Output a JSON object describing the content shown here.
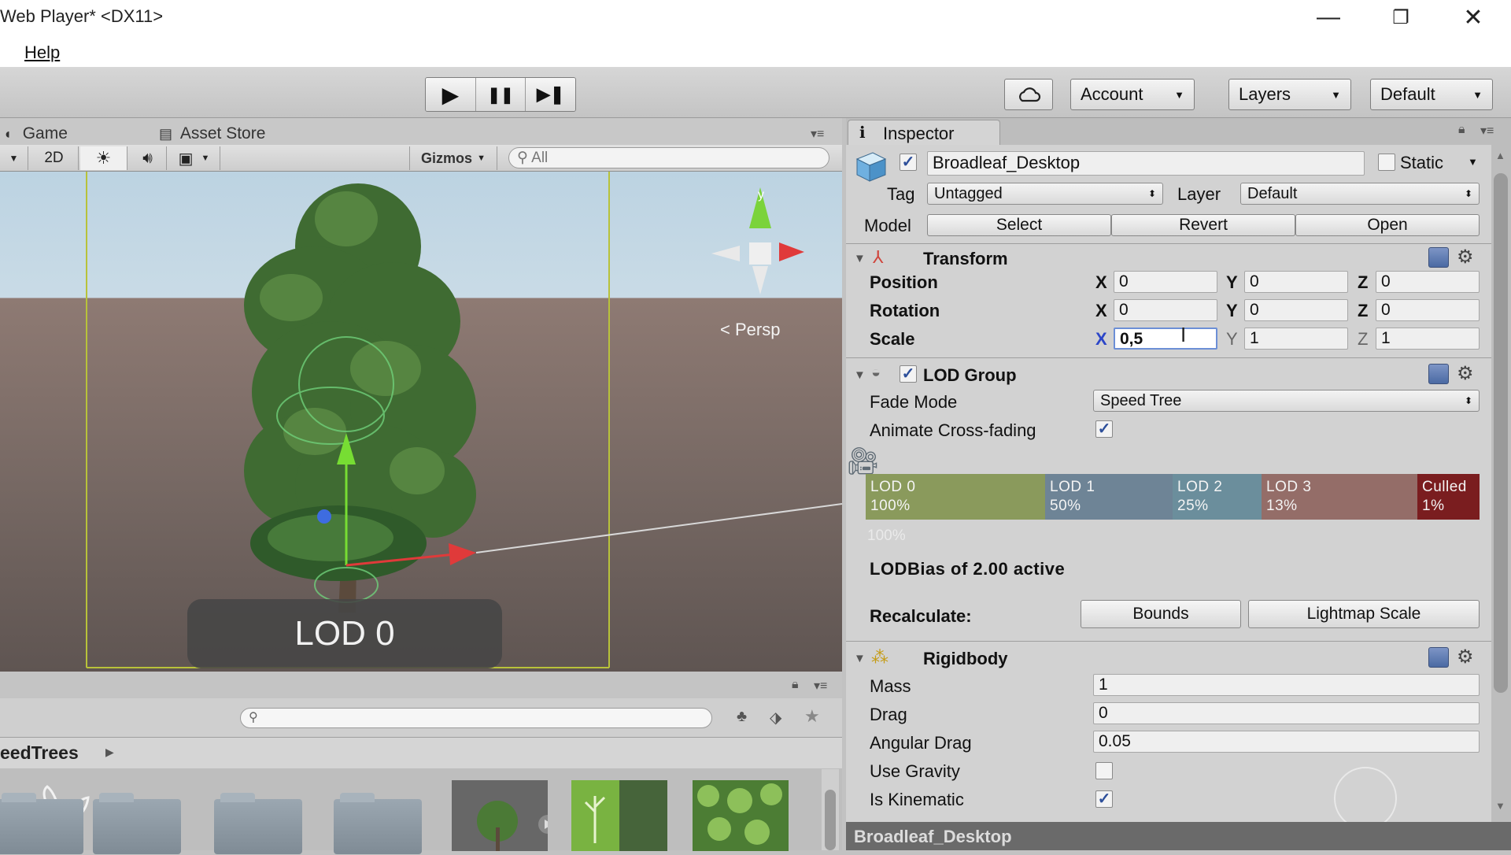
{
  "window": {
    "title": "Web Player* <DX11>",
    "minimize": "—",
    "restore": "❐",
    "close": "✕"
  },
  "menu": {
    "help": "Help"
  },
  "toolbar": {
    "play": "▶",
    "pause": "❚❚",
    "step": "▶❚",
    "cloud_icon": "cloud-icon",
    "account": "Account",
    "layers": "Layers",
    "layout": "Default",
    "caret": "▼"
  },
  "scene": {
    "tab_game": "Game",
    "tab_asset_store": "Asset Store",
    "mode_2d": "2D",
    "gizmos": "Gizmos",
    "search_placeholder": "All",
    "persp": "Persp",
    "lod_overlay": "LOD 0",
    "gizmo_y": "y"
  },
  "project": {
    "breadcrumb": "eedTrees"
  },
  "inspector": {
    "tab": "Inspector",
    "object": {
      "name": "Broadleaf_Desktop",
      "active": true,
      "static_label": "Static",
      "static": false
    },
    "tag_label": "Tag",
    "tag": "Untagged",
    "layer_label": "Layer",
    "layer": "Default",
    "model_label": "Model",
    "select": "Select",
    "revert": "Revert",
    "open": "Open",
    "transform": {
      "title": "Transform",
      "position_label": "Position",
      "rotation_label": "Rotation",
      "scale_label": "Scale",
      "x": "X",
      "y": "Y",
      "z": "Z",
      "position": [
        "0",
        "0",
        "0"
      ],
      "rotation": [
        "0",
        "0",
        "0"
      ],
      "scale": [
        "0,5",
        "1",
        "1"
      ]
    },
    "lod_group": {
      "title": "LOD Group",
      "enabled": true,
      "fade_mode_label": "Fade Mode",
      "fade_mode": "Speed Tree",
      "cross_fade_label": "Animate Cross-fading",
      "cross_fade": true,
      "levels": [
        {
          "name": "LOD 0",
          "pct": "100%",
          "color": "#8a9a5c"
        },
        {
          "name": "LOD 1",
          "pct": "50%",
          "color": "#6e8496"
        },
        {
          "name": "LOD 2",
          "pct": "25%",
          "color": "#6b8e9c"
        },
        {
          "name": "LOD 3",
          "pct": "13%",
          "color": "#946d68"
        },
        {
          "name": "Culled",
          "pct": "1%",
          "color": "#7a1d1f"
        }
      ],
      "camera_pct": "100%",
      "bias_text": "LODBias of 2.00 active",
      "recalc_label": "Recalculate:",
      "bounds": "Bounds",
      "lightmap_scale": "Lightmap Scale"
    },
    "rigidbody": {
      "title": "Rigidbody",
      "mass_label": "Mass",
      "mass": "1",
      "drag_label": "Drag",
      "drag": "0",
      "angular_drag_label": "Angular Drag",
      "angular_drag": "0.05",
      "gravity_label": "Use Gravity",
      "gravity": false,
      "kinematic_label": "Is Kinematic",
      "kinematic": true
    },
    "footer": "Broadleaf_Desktop"
  }
}
